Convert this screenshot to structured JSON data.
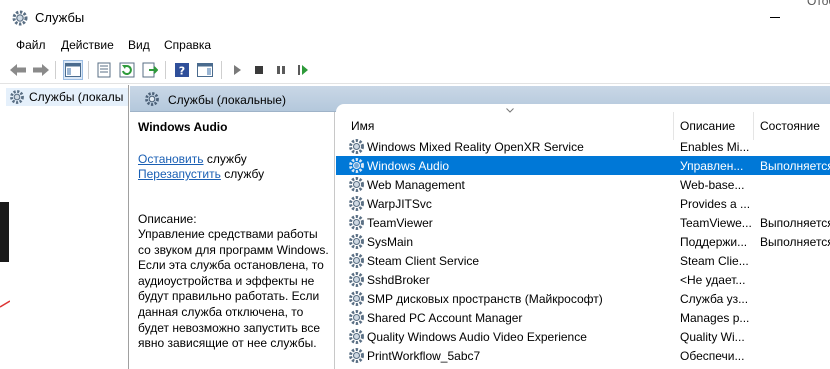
{
  "window": {
    "title": "Службы",
    "clipped_top_right": "Отобра"
  },
  "menu": [
    "Файл",
    "Действие",
    "Вид",
    "Справка"
  ],
  "toolbar": {
    "buttons": [
      "back-icon",
      "forward-icon",
      "show-hide-console-tree-icon",
      "properties-icon",
      "refresh-icon",
      "export-list-icon",
      "help-icon",
      "action-pane-icon",
      "start-service-icon",
      "stop-service-icon",
      "pause-service-icon",
      "resume-service-icon"
    ]
  },
  "tree": {
    "selected_item": "Службы (локалы"
  },
  "pane_header": "Службы (локальные)",
  "description_pane": {
    "service_name": "Windows Audio",
    "stop_link": "Остановить",
    "stop_suffix": " службу",
    "restart_link": "Перезапустить",
    "restart_suffix": " службу",
    "description_label": "Описание:",
    "description_text": "Управление средствами работы со звуком для программ Windows. Если эта служба остановлена, то аудиоустройства и эффекты не будут правильно работать.  Если данная служба отключена, то будет невозможно запустить все явно зависящие от нее службы."
  },
  "columns": {
    "name": "Имя",
    "description": "Описание",
    "status": "Состояние"
  },
  "services": [
    {
      "name": "Windows Mixed Reality OpenXR Service",
      "description": "Enables Mi...",
      "status": ""
    },
    {
      "name": "Windows Audio",
      "description": "Управлен...",
      "status": "Выполняется",
      "selected": true
    },
    {
      "name": "Web Management",
      "description": "Web-base...",
      "status": ""
    },
    {
      "name": "WarpJITSvc",
      "description": "Provides a ...",
      "status": ""
    },
    {
      "name": "TeamViewer",
      "description": "TeamViewe...",
      "status": "Выполняется"
    },
    {
      "name": "SysMain",
      "description": "Поддержи...",
      "status": "Выполняется"
    },
    {
      "name": "Steam Client Service",
      "description": "Steam Clie...",
      "status": ""
    },
    {
      "name": "SshdBroker",
      "description": "<Не удает...",
      "status": ""
    },
    {
      "name": "SMP дисковых пространств (Майкрософт)",
      "description": "Служба уз...",
      "status": ""
    },
    {
      "name": "Shared PC Account Manager",
      "description": "Manages p...",
      "status": ""
    },
    {
      "name": "Quality Windows Audio Video Experience",
      "description": "Quality Wi...",
      "status": ""
    },
    {
      "name": "PrintWorkflow_5abc7",
      "description": "Обеспечи...",
      "status": ""
    }
  ],
  "colors": {
    "selection": "#0078d7",
    "header_band": "#b4c8dc",
    "link": "#1a5fb4"
  }
}
